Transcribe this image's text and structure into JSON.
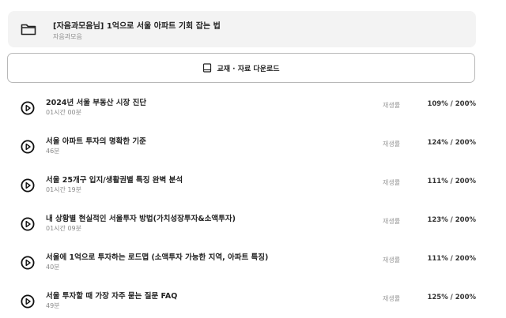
{
  "course": {
    "title": "[자음과모음님] 1억으로 서울 아파트 기회 잡는 법",
    "author": "자음과모음"
  },
  "download": {
    "label": "교재 · 자료 다운로드"
  },
  "rate_label": "재생률",
  "lessons": [
    {
      "title": "2024년 서울 부동산 시장 진단",
      "duration": "01시간 00분",
      "rate": "109% / 200%"
    },
    {
      "title": "서울 아파트 투자의 명확한 기준",
      "duration": "46분",
      "rate": "124% / 200%"
    },
    {
      "title": "서울 25개구 입지/생활권별 특징 완벽 분석",
      "duration": "01시간 19분",
      "rate": "111% / 200%"
    },
    {
      "title": "내 상황별 현실적인 서울투자 방법(가치성장투자&소액투자)",
      "duration": "01시간 09분",
      "rate": "123% / 200%"
    },
    {
      "title": "서울에 1억으로 투자하는 로드맵 (소액투자 가능한 지역, 아파트 특징)",
      "duration": "40분",
      "rate": "111% / 200%"
    },
    {
      "title": "서울 투자할 때 가장 자주 묻는 질문 FAQ",
      "duration": "49분",
      "rate": "125% / 200%"
    }
  ]
}
